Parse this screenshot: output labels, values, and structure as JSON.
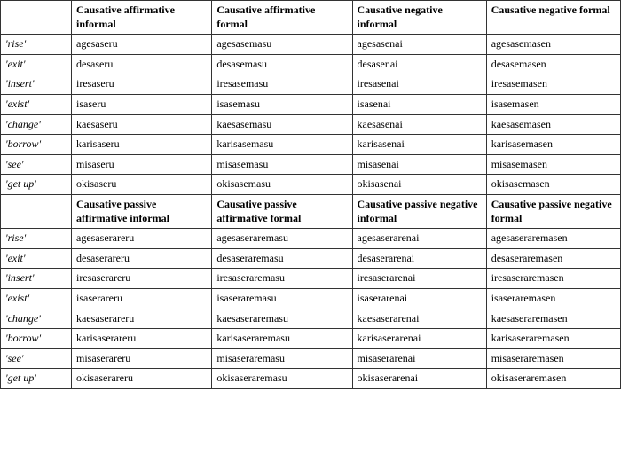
{
  "table": {
    "section1": {
      "headers": [
        "",
        "Causative affirmative informal",
        "Causative affirmative formal",
        "Causative negative informal",
        "Causative negative formal"
      ],
      "rows": [
        {
          "word": "'rise'",
          "c1": "agesaseru",
          "c2": "agesasemasu",
          "c3": "agesasenai",
          "c4": "agesasemasen"
        },
        {
          "word": "'exit'",
          "c1": "desaseru",
          "c2": "desasemasu",
          "c3": "desasenai",
          "c4": "desasemasen"
        },
        {
          "word": "'insert'",
          "c1": "iresaseru",
          "c2": "iresasemasu",
          "c3": "iresasenai",
          "c4": "iresasemasen"
        },
        {
          "word": "'exist'",
          "c1": "isaseru",
          "c2": "isasemasu",
          "c3": "isasenai",
          "c4": "isasemasen"
        },
        {
          "word": "'change'",
          "c1": "kaesaseru",
          "c2": "kaesasemasu",
          "c3": "kaesasenai",
          "c4": "kaesasemasen"
        },
        {
          "word": "'borrow'",
          "c1": "karisaseru",
          "c2": "karisasemasu",
          "c3": "karisasenai",
          "c4": "karisasemasen"
        },
        {
          "word": "'see'",
          "c1": "misaseru",
          "c2": "misasemasu",
          "c3": "misasenai",
          "c4": "misasemasen"
        },
        {
          "word": "'get up'",
          "c1": "okisaseru",
          "c2": "okisasemasu",
          "c3": "okisasenai",
          "c4": "okisasemasen"
        }
      ]
    },
    "section2": {
      "headers": [
        "",
        "Causative passive affirmative informal",
        "Causative passive affirmative formal",
        "Causative passive negative informal",
        "Causative passive negative formal"
      ],
      "rows": [
        {
          "word": "'rise'",
          "c1": "agesaserareru",
          "c2": "agesaseraremasu",
          "c3": "agesaserarenai",
          "c4": "agesaseraremasen"
        },
        {
          "word": "'exit'",
          "c1": "desaserareru",
          "c2": "desaseraremasu",
          "c3": "desaserarenai",
          "c4": "desaseraremasen"
        },
        {
          "word": "'insert'",
          "c1": "iresaserareru",
          "c2": "iresaseraremasu",
          "c3": "iresaserarenai",
          "c4": "iresaseraremasen"
        },
        {
          "word": "'exist'",
          "c1": "isaserareru",
          "c2": "isaseraremasu",
          "c3": "isaserarenai",
          "c4": "isaseraremasen"
        },
        {
          "word": "'change'",
          "c1": "kaesaserareru",
          "c2": "kaesaseraremasu",
          "c3": "kaesaserarenai",
          "c4": "kaesaseraremasen"
        },
        {
          "word": "'borrow'",
          "c1": "karisaserareru",
          "c2": "karisaseraremasu",
          "c3": "karisaserarenai",
          "c4": "karisaseraremasen"
        },
        {
          "word": "'see'",
          "c1": "misaserareru",
          "c2": "misaseraremasu",
          "c3": "misaserarenai",
          "c4": "misaseraremasen"
        },
        {
          "word": "'get up'",
          "c1": "okisaserareru",
          "c2": "okisaseraremasu",
          "c3": "okisaserarenai",
          "c4": "okisaseraremasen"
        }
      ]
    }
  }
}
